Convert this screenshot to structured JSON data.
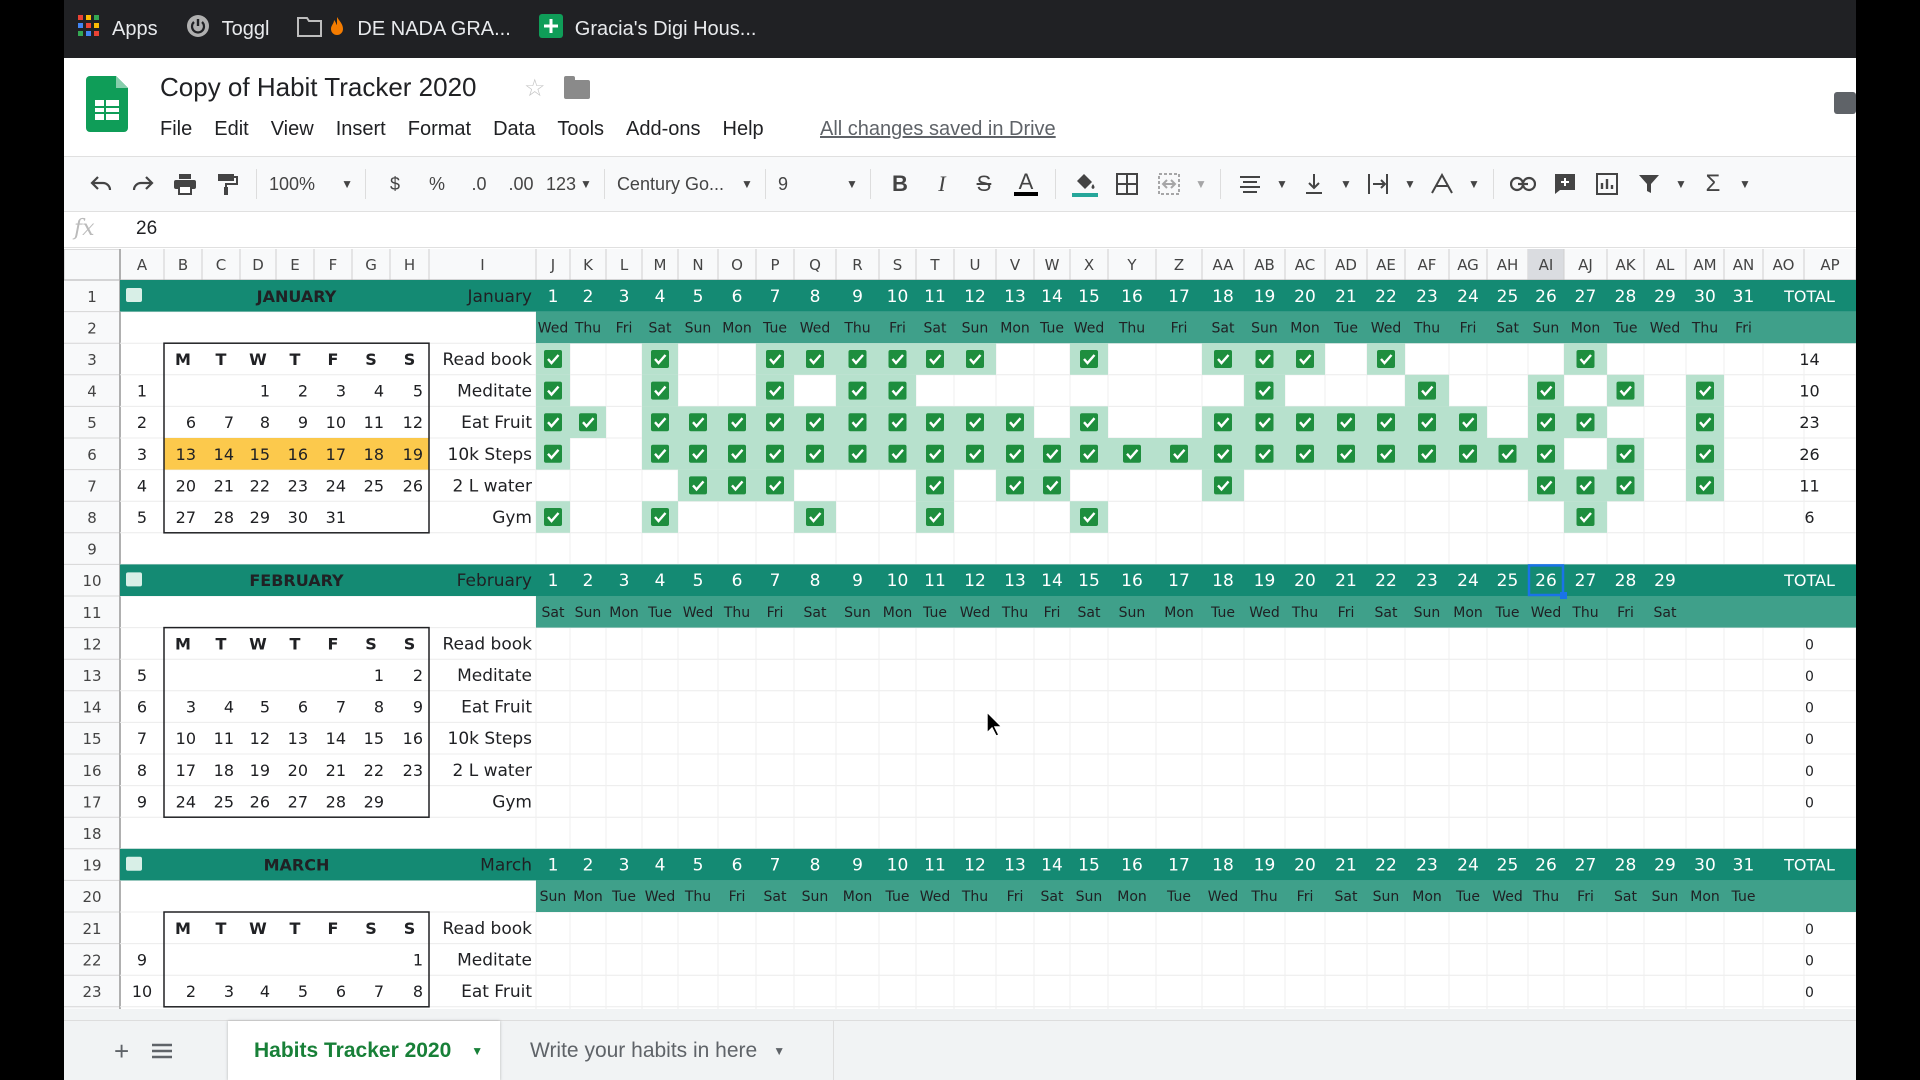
{
  "bookmarks": [
    {
      "label": "Apps",
      "icon": "apps-grid-icon"
    },
    {
      "label": "Toggl",
      "icon": "power-icon"
    },
    {
      "label": "DE NADA GRA...",
      "icon": "folder-fire-icon"
    },
    {
      "label": "Gracia's Digi Hous...",
      "icon": "sheets-plus-icon"
    }
  ],
  "doc": {
    "title": "Copy of Habit Tracker 2020",
    "save_status": "All changes saved in Drive"
  },
  "menu": [
    "File",
    "Edit",
    "View",
    "Insert",
    "Format",
    "Data",
    "Tools",
    "Add-ons",
    "Help"
  ],
  "toolbar": {
    "zoom": "100%",
    "currency": "$",
    "percent": "%",
    "dec_less": ".0",
    "dec_more": ".00",
    "format_more": "123",
    "font": "Century Go...",
    "font_size": "9"
  },
  "formula_bar": {
    "fx": "fx",
    "value": "26"
  },
  "colors": {
    "teal": "#148a73",
    "teal_light": "#3fa08a",
    "check_bg": "#b7e1cd",
    "check": "#1e8e3e",
    "highlight": "#fbc02d",
    "selected_col": "#e8eaed"
  },
  "columns": [
    "A",
    "B",
    "C",
    "D",
    "E",
    "F",
    "G",
    "H",
    "I",
    "J",
    "K",
    "L",
    "M",
    "N",
    "O",
    "P",
    "Q",
    "R",
    "S",
    "T",
    "U",
    "V",
    "W",
    "X",
    "Y",
    "Z",
    "AA",
    "AB",
    "AC",
    "AD",
    "AE",
    "AF",
    "AG",
    "AH",
    "AI",
    "AJ",
    "AK",
    "AL",
    "AM",
    "AN",
    "AO",
    "AP"
  ],
  "row_numbers": [
    "1",
    "2",
    "3",
    "4",
    "5",
    "6",
    "7",
    "8",
    "9",
    "10",
    "11",
    "12",
    "13",
    "14",
    "15",
    "16",
    "17",
    "18",
    "19",
    "20",
    "21",
    "22",
    "23"
  ],
  "weekday_header": [
    "M",
    "T",
    "W",
    "T",
    "F",
    "S",
    "S"
  ],
  "habits": [
    "Read book",
    "Meditate",
    "Eat Fruit",
    "10k Steps",
    "2 L water",
    "Gym"
  ],
  "total_label": "TOTAL",
  "months": [
    {
      "name_caps": "JANUARY",
      "name": "January",
      "days": [
        "1",
        "2",
        "3",
        "4",
        "5",
        "6",
        "7",
        "8",
        "9",
        "10",
        "11",
        "12",
        "13",
        "14",
        "15",
        "16",
        "17",
        "18",
        "19",
        "20",
        "21",
        "22",
        "23",
        "24",
        "25",
        "26",
        "27",
        "28",
        "29",
        "30",
        "31"
      ],
      "weekdays": [
        "Wed",
        "Thu",
        "Fri",
        "Sat",
        "Sun",
        "Mon",
        "Tue",
        "Wed",
        "Thu",
        "Fri",
        "Sat",
        "Sun",
        "Mon",
        "Tue",
        "Wed",
        "Thu",
        "Fri",
        "Sat",
        "Sun",
        "Mon",
        "Tue",
        "Wed",
        "Thu",
        "Fri",
        "Sat",
        "Sun",
        "Mon",
        "Tue",
        "Wed",
        "Thu",
        "Fri"
      ],
      "calendar": [
        {
          "week": "1",
          "days": [
            "",
            "",
            "1",
            "2",
            "3",
            "4",
            "5"
          ]
        },
        {
          "week": "2",
          "days": [
            "6",
            "7",
            "8",
            "9",
            "10",
            "11",
            "12"
          ]
        },
        {
          "week": "3",
          "days": [
            "13",
            "14",
            "15",
            "16",
            "17",
            "18",
            "19"
          ]
        },
        {
          "week": "4",
          "days": [
            "20",
            "21",
            "22",
            "23",
            "24",
            "25",
            "26"
          ]
        },
        {
          "week": "5",
          "days": [
            "27",
            "28",
            "29",
            "30",
            "31",
            "",
            ""
          ]
        }
      ],
      "highlight_week": 2,
      "checks": [
        [
          1,
          4,
          7,
          8,
          9,
          10,
          11,
          12,
          15,
          18,
          19,
          20,
          22,
          27
        ],
        [
          1,
          4,
          7,
          9,
          10,
          19,
          23,
          26,
          28,
          30
        ],
        [
          1,
          2,
          4,
          5,
          6,
          7,
          8,
          9,
          10,
          11,
          12,
          13,
          15,
          18,
          19,
          20,
          21,
          22,
          23,
          24,
          26,
          27,
          30
        ],
        [
          1,
          4,
          5,
          6,
          7,
          8,
          9,
          10,
          11,
          12,
          13,
          14,
          15,
          16,
          17,
          18,
          19,
          20,
          21,
          22,
          23,
          24,
          25,
          26,
          28,
          30
        ],
        [
          5,
          6,
          7,
          11,
          13,
          14,
          18,
          26,
          27,
          28,
          30
        ],
        [
          1,
          4,
          8,
          11,
          15,
          27
        ]
      ],
      "totals": [
        "14",
        "10",
        "23",
        "26",
        "11",
        "6"
      ]
    },
    {
      "name_caps": "FEBRUARY",
      "name": "February",
      "days": [
        "1",
        "2",
        "3",
        "4",
        "5",
        "6",
        "7",
        "8",
        "9",
        "10",
        "11",
        "12",
        "13",
        "14",
        "15",
        "16",
        "17",
        "18",
        "19",
        "20",
        "21",
        "22",
        "23",
        "24",
        "25",
        "26",
        "27",
        "28",
        "29"
      ],
      "weekdays": [
        "Sat",
        "Sun",
        "Mon",
        "Tue",
        "Wed",
        "Thu",
        "Fri",
        "Sat",
        "Sun",
        "Mon",
        "Tue",
        "Wed",
        "Thu",
        "Fri",
        "Sat",
        "Sun",
        "Mon",
        "Tue",
        "Wed",
        "Thu",
        "Fri",
        "Sat",
        "Sun",
        "Mon",
        "Tue",
        "Wed",
        "Thu",
        "Fri",
        "Sat"
      ],
      "calendar": [
        {
          "week": "5",
          "days": [
            "",
            "",
            "",
            "",
            "",
            "1",
            "2"
          ]
        },
        {
          "week": "6",
          "days": [
            "3",
            "4",
            "5",
            "6",
            "7",
            "8",
            "9"
          ]
        },
        {
          "week": "7",
          "days": [
            "10",
            "11",
            "12",
            "13",
            "14",
            "15",
            "16"
          ]
        },
        {
          "week": "8",
          "days": [
            "17",
            "18",
            "19",
            "20",
            "21",
            "22",
            "23"
          ]
        },
        {
          "week": "9",
          "days": [
            "24",
            "25",
            "26",
            "27",
            "28",
            "29",
            ""
          ]
        }
      ],
      "checks": [
        [],
        [],
        [],
        [],
        [],
        []
      ],
      "totals": [
        "0",
        "0",
        "0",
        "0",
        "0",
        "0"
      ]
    },
    {
      "name_caps": "MARCH",
      "name": "March",
      "days": [
        "1",
        "2",
        "3",
        "4",
        "5",
        "6",
        "7",
        "8",
        "9",
        "10",
        "11",
        "12",
        "13",
        "14",
        "15",
        "16",
        "17",
        "18",
        "19",
        "20",
        "21",
        "22",
        "23",
        "24",
        "25",
        "26",
        "27",
        "28",
        "29",
        "30",
        "31"
      ],
      "weekdays": [
        "Sun",
        "Mon",
        "Tue",
        "Wed",
        "Thu",
        "Fri",
        "Sat",
        "Sun",
        "Mon",
        "Tue",
        "Wed",
        "Thu",
        "Fri",
        "Sat",
        "Sun",
        "Mon",
        "Tue",
        "Wed",
        "Thu",
        "Fri",
        "Sat",
        "Sun",
        "Mon",
        "Tue",
        "Wed",
        "Thu",
        "Fri",
        "Sat",
        "Sun",
        "Mon",
        "Tue"
      ],
      "calendar": [
        {
          "week": "9",
          "days": [
            "",
            "",
            "",
            "",
            "",
            "",
            "1"
          ]
        },
        {
          "week": "10",
          "days": [
            "2",
            "3",
            "4",
            "5",
            "6",
            "7",
            "8"
          ]
        }
      ],
      "checks": [
        [],
        [],
        []
      ],
      "totals": [
        "0",
        "0",
        "0"
      ]
    }
  ],
  "sheet_tabs": [
    {
      "label": "Habits Tracker 2020",
      "active": true
    },
    {
      "label": "Write your habits in here",
      "active": false
    }
  ]
}
